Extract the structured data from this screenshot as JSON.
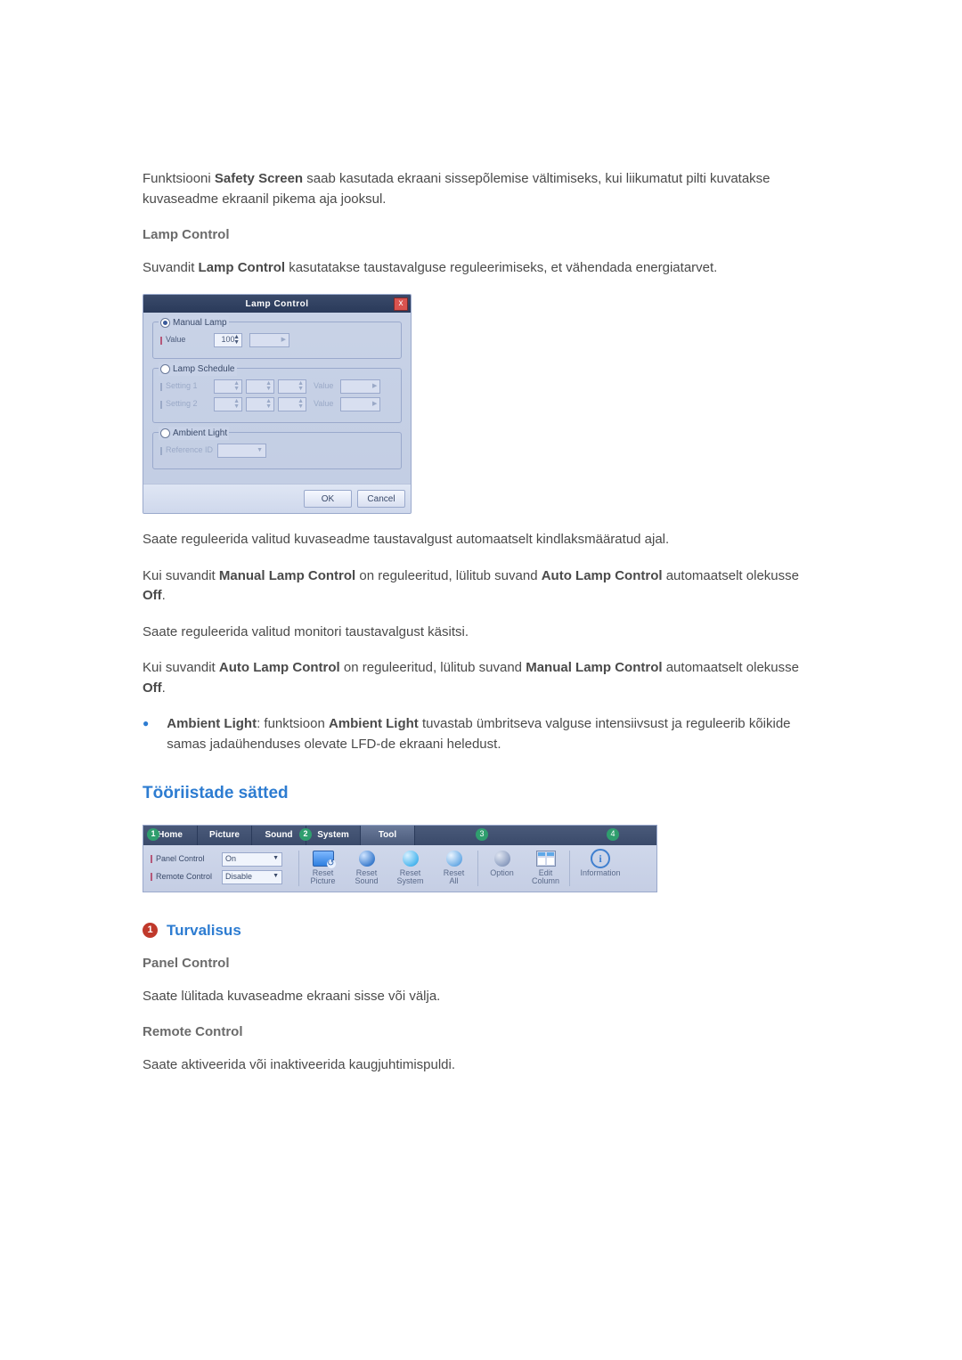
{
  "intro": {
    "safety_prefix": "Funktsiooni ",
    "safety_b": "Safety Screen",
    "safety_rest": " saab kasutada ekraani sissepõlemise vältimiseks, kui liikumatut pilti kuvatakse kuvaseadme ekraanil pikema aja jooksul."
  },
  "lamp": {
    "heading": "Lamp Control",
    "desc_prefix": "Suvandit ",
    "desc_b": "Lamp Control",
    "desc_rest": " kasutatakse taustavalguse reguleerimiseks, et vähendada energiatarvet.",
    "after1": "Saate reguleerida valitud kuvaseadme taustavalgust automaatselt kindlaksmääratud ajal.",
    "after2_pre": "Kui suvandit ",
    "after2_b1": "Manual Lamp Control",
    "after2_mid": " on reguleeritud, lülitub suvand ",
    "after2_b2": "Auto Lamp Control",
    "after2_end": " automaatselt olekusse ",
    "after2_off": "Off",
    "after3": "Saate reguleerida valitud monitori taustavalgust käsitsi.",
    "after4_pre": "Kui suvandit ",
    "after4_b1": "Auto Lamp Control",
    "after4_mid": " on reguleeritud, lülitub suvand ",
    "after4_b2": "Manual Lamp Control",
    "after4_end": " automaatselt olekusse ",
    "after4_off": "Off",
    "bullet_b": "Ambient Light",
    "bullet_colon": ": funktsioon ",
    "bullet_b2": "Ambient Light",
    "bullet_rest": " tuvastab ümbritseva valguse intensiivsust ja reguleerib kõikide samas jadaühenduses olevate LFD-de ekraani heledust."
  },
  "dlg": {
    "title": "Lamp Control",
    "close": "x",
    "manual_legend": "Manual Lamp",
    "value_label": "Value",
    "value": "100",
    "schedule_legend": "Lamp Schedule",
    "setting1": "Setting 1",
    "setting2": "Setting 2",
    "value_word": "Value",
    "ambient_legend": "Ambient Light",
    "ref_label": "Reference ID",
    "ok": "OK",
    "cancel": "Cancel"
  },
  "tools": {
    "heading": "Tööriistade sätted",
    "tabs": {
      "home": "Home",
      "picture": "Picture",
      "sound": "Sound",
      "system": "System",
      "tool": "Tool"
    },
    "marks": {
      "m1": "1",
      "m2": "2",
      "m3": "3",
      "m4": "4"
    },
    "panel_label": "Panel Control",
    "panel_value": "On",
    "remote_label": "Remote Control",
    "remote_value": "Disable",
    "btns": {
      "reset_picture_l1": "Reset",
      "reset_picture_l2": "Picture",
      "reset_sound_l1": "Reset",
      "reset_sound_l2": "Sound",
      "reset_system_l1": "Reset",
      "reset_system_l2": "System",
      "reset_all_l1": "Reset",
      "reset_all_l2": "All",
      "option": "Option",
      "edit_l1": "Edit",
      "edit_l2": "Column",
      "info": "Information"
    }
  },
  "sec1": {
    "num": "1",
    "title": "Turvalisus",
    "panel_h": "Panel Control",
    "panel_p": "Saate lülitada kuvaseadme ekraani sisse või välja.",
    "remote_h": "Remote Control",
    "remote_p": "Saate aktiveerida või inaktiveerida kaugjuhtimispuldi."
  }
}
